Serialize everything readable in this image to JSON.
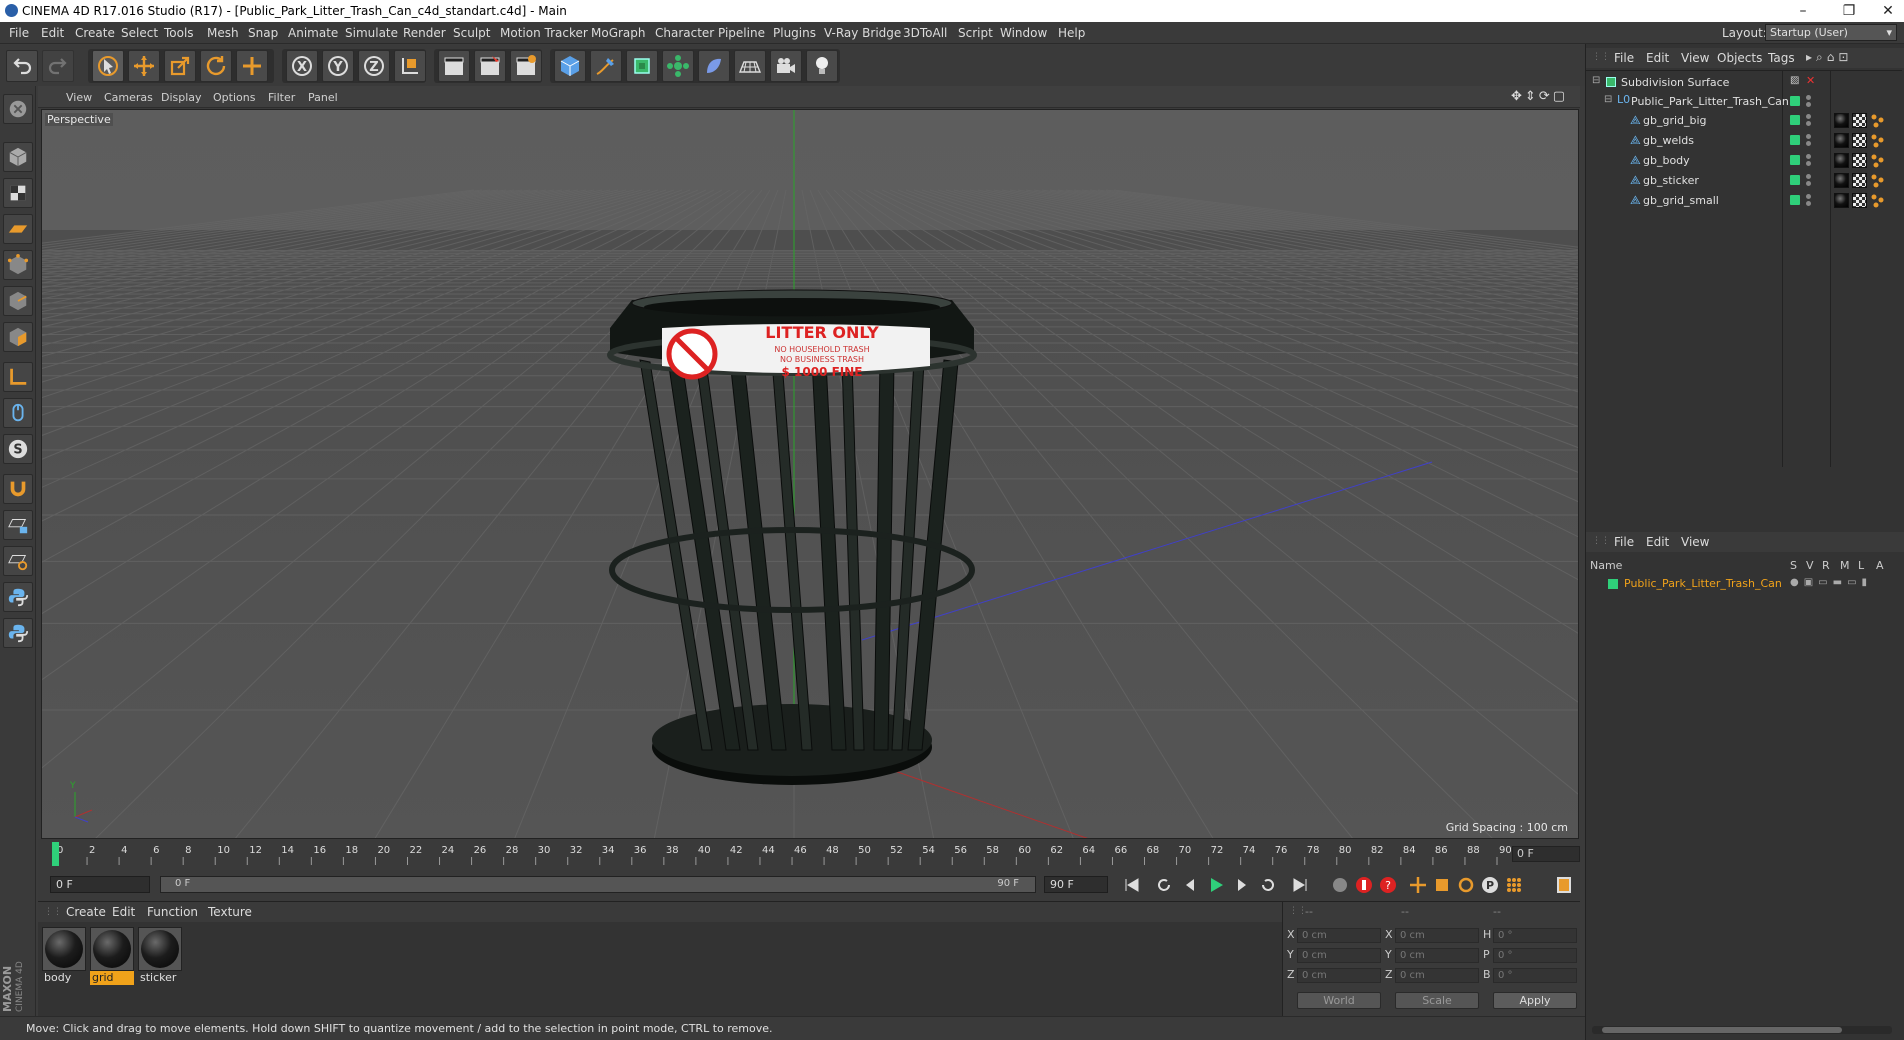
{
  "window": {
    "title": "CINEMA 4D R17.016 Studio (R17) - [Public_Park_Litter_Trash_Can_c4d_standart.c4d] - Main",
    "minimize": "–",
    "maximize": "❐",
    "close": "✕"
  },
  "menubar": {
    "items": [
      "File",
      "Edit",
      "Create",
      "Select",
      "Tools",
      "Mesh",
      "Snap",
      "Animate",
      "Simulate",
      "Render",
      "Sculpt",
      "Motion Tracker",
      "MoGraph",
      "Character",
      "Pipeline",
      "Plugins",
      "V-Ray Bridge",
      "3DToAll",
      "Script",
      "Window",
      "Help"
    ],
    "layout_label": "Layout:",
    "layout_value": "Startup (User)"
  },
  "viewport": {
    "menu": [
      "View",
      "Cameras",
      "Display",
      "Options",
      "Filter",
      "Panel"
    ],
    "camera_label": "Perspective",
    "grid_spacing": "Grid Spacing : 100 cm",
    "sticker_lines": [
      "LITTER ONLY",
      "NO HOUSEHOLD TRASH",
      "NO BUSINESS TRASH",
      "$ 1000 FINE"
    ]
  },
  "timeline": {
    "ticks": [
      "0",
      "2",
      "4",
      "6",
      "8",
      "10",
      "12",
      "14",
      "16",
      "18",
      "20",
      "22",
      "24",
      "26",
      "28",
      "30",
      "32",
      "34",
      "36",
      "38",
      "40",
      "42",
      "44",
      "46",
      "48",
      "50",
      "52",
      "54",
      "56",
      "58",
      "60",
      "62",
      "64",
      "66",
      "68",
      "70",
      "72",
      "74",
      "76",
      "78",
      "80",
      "82",
      "84",
      "86",
      "88",
      "90"
    ],
    "current_frame": "0 F",
    "start_field": "0 F",
    "range_start": "0 F",
    "range_end": "90 F",
    "end_field": "90 F"
  },
  "materials": {
    "menu": [
      "Create",
      "Edit",
      "Function",
      "Texture"
    ],
    "items": [
      {
        "name": "body",
        "selected": false
      },
      {
        "name": "grid",
        "selected": true
      },
      {
        "name": "sticker",
        "selected": false
      }
    ]
  },
  "coordinates": {
    "headers": [
      "--",
      "--",
      "--"
    ],
    "rows": [
      {
        "a": "X",
        "v1": "0 cm",
        "b": "X",
        "v2": "0 cm",
        "c": "H",
        "v3": "0 °"
      },
      {
        "a": "Y",
        "v1": "0 cm",
        "b": "Y",
        "v2": "0 cm",
        "c": "P",
        "v3": "0 °"
      },
      {
        "a": "Z",
        "v1": "0 cm",
        "b": "Z",
        "v2": "0 cm",
        "c": "B",
        "v3": "0 °"
      }
    ],
    "world": "World",
    "scale": "Scale",
    "apply": "Apply"
  },
  "object_manager": {
    "menu": [
      "File",
      "Edit",
      "View",
      "Objects",
      "Tags"
    ],
    "objects": [
      {
        "name": "Subdivision Surface",
        "level": 0
      },
      {
        "name": "Public_Park_Litter_Trash_Can",
        "level": 1
      },
      {
        "name": "gb_grid_big",
        "level": 2
      },
      {
        "name": "gb_welds",
        "level": 2
      },
      {
        "name": "gb_body",
        "level": 2
      },
      {
        "name": "gb_sticker",
        "level": 2
      },
      {
        "name": "gb_grid_small",
        "level": 2
      }
    ]
  },
  "layer_manager": {
    "menu": [
      "File",
      "Edit",
      "View"
    ],
    "columns": [
      "Name",
      "S",
      "V",
      "R",
      "M",
      "L",
      "A"
    ],
    "layer_name": "Public_Park_Litter_Trash_Can"
  },
  "status": {
    "text": "Move: Click and drag to move elements. Hold down SHIFT to quantize movement / add to the selection in point mode, CTRL to remove."
  },
  "brand": {
    "logo_text": "MAXON CINEMA 4D"
  },
  "colors": {
    "accent": "#f0a21a",
    "layer_green": "#2fd07a",
    "selection_orange": "#f0a21a"
  }
}
